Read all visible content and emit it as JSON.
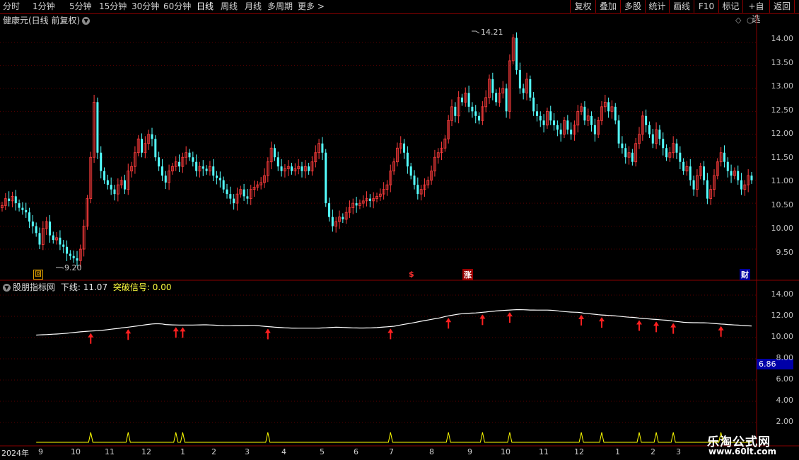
{
  "toolbar": {
    "periods": [
      "分时",
      "1分钟",
      "5分钟",
      "15分钟",
      "30分钟",
      "60分钟",
      "日线",
      "周线",
      "月线",
      "多周期",
      "更多 >"
    ],
    "active_period": "日线",
    "right_buttons": [
      "复权",
      "叠加",
      "多股",
      "统计",
      "画线",
      "F10",
      "标记",
      "+自选",
      "返回"
    ]
  },
  "main_panel": {
    "title": "健康元(日线 前复权)",
    "high_label": "14.21",
    "low_label": "9.20",
    "y_ticks": [
      "14.00",
      "13.50",
      "13.00",
      "12.50",
      "12.00",
      "11.50",
      "11.00",
      "10.50",
      "10.00",
      "9.50"
    ],
    "markers": {
      "hui": "回",
      "dollar": "$",
      "zhang": "涨",
      "cai": "财"
    }
  },
  "indicator_panel": {
    "name": "股朋指标网",
    "line_label": "下线:",
    "line_value": "11.07",
    "signal_label": "突破信号:",
    "signal_value": "0.00",
    "y_ticks": [
      "14.00",
      "12.00",
      "10.00",
      "8.00",
      "6.00",
      "4.00",
      "2.00"
    ],
    "price_tag": "6.86"
  },
  "x_axis": {
    "year_label": "2024年",
    "months": [
      "9",
      "10",
      "11",
      "12",
      "1",
      "2",
      "3",
      "4",
      "5",
      "6",
      "7",
      "8",
      "9",
      "10",
      "11",
      "12",
      "1",
      "2",
      "3"
    ]
  },
  "watermark": {
    "name": "乐淘公式网",
    "url": "www.60lt.com"
  },
  "colors": {
    "up": "#ff3c3c",
    "down": "#54ffff",
    "line": "#ffffff",
    "signal": "#ffff00",
    "border": "#8a0000",
    "tag_bg": "#0000a8"
  },
  "chart_data": {
    "type": "candlestick",
    "ylim_main": [
      9.1,
      14.4
    ],
    "ylim_indicator": [
      0,
      15
    ],
    "closes": [
      10.45,
      10.6,
      10.55,
      10.65,
      10.5,
      10.4,
      10.35,
      10.3,
      10.1,
      10.0,
      9.85,
      9.6,
      9.95,
      10.1,
      9.8,
      9.7,
      9.75,
      9.6,
      9.55,
      9.4,
      9.35,
      9.3,
      9.25,
      9.5,
      10.0,
      10.6,
      11.5,
      12.7,
      11.6,
      11.2,
      11.0,
      10.9,
      10.8,
      10.7,
      10.9,
      11.0,
      10.8,
      11.2,
      11.3,
      11.6,
      11.9,
      11.6,
      11.8,
      12.0,
      11.9,
      11.5,
      11.3,
      11.1,
      10.95,
      11.2,
      11.3,
      11.4,
      11.3,
      11.5,
      11.6,
      11.5,
      11.4,
      11.2,
      11.3,
      11.25,
      11.2,
      11.3,
      11.1,
      11.05,
      11.0,
      10.8,
      10.7,
      10.6,
      10.5,
      10.7,
      10.8,
      10.65,
      10.6,
      10.8,
      10.85,
      10.9,
      10.95,
      11.1,
      11.4,
      11.7,
      11.5,
      11.3,
      11.2,
      11.25,
      11.3,
      11.2,
      11.25,
      11.3,
      11.2,
      11.3,
      11.2,
      11.4,
      11.6,
      11.8,
      11.6,
      10.5,
      10.2,
      10.0,
      10.1,
      10.2,
      10.15,
      10.3,
      10.4,
      10.5,
      10.45,
      10.5,
      10.55,
      10.6,
      10.55,
      10.6,
      10.65,
      10.7,
      10.8,
      10.9,
      11.2,
      11.4,
      11.7,
      11.8,
      11.6,
      11.3,
      11.1,
      10.9,
      10.7,
      10.8,
      10.9,
      11.0,
      11.2,
      11.5,
      11.6,
      11.7,
      11.9,
      12.3,
      12.6,
      12.4,
      12.8,
      12.7,
      12.9,
      12.6,
      12.5,
      12.4,
      12.3,
      12.6,
      12.8,
      13.2,
      12.9,
      12.7,
      12.9,
      13.0,
      12.5,
      13.6,
      14.1,
      13.4,
      13.0,
      12.9,
      13.2,
      12.8,
      12.5,
      12.4,
      12.3,
      12.2,
      12.5,
      12.3,
      12.2,
      12.1,
      12.0,
      12.3,
      12.1,
      12.0,
      12.2,
      12.5,
      12.6,
      12.3,
      12.4,
      12.2,
      12.0,
      12.3,
      12.6,
      12.7,
      12.5,
      12.6,
      12.3,
      11.8,
      11.7,
      11.5,
      11.6,
      11.4,
      11.8,
      12.0,
      12.4,
      12.2,
      12.0,
      11.8,
      12.1,
      11.9,
      11.7,
      11.5,
      11.6,
      11.8,
      11.6,
      11.4,
      11.2,
      11.3,
      11.0,
      10.8,
      11.1,
      11.3,
      11.0,
      10.6,
      10.8,
      11.1,
      11.4,
      11.6,
      11.4,
      11.2,
      11.1,
      11.2,
      11.0,
      10.8,
      10.9,
      11.1,
      11.0
    ]
  }
}
